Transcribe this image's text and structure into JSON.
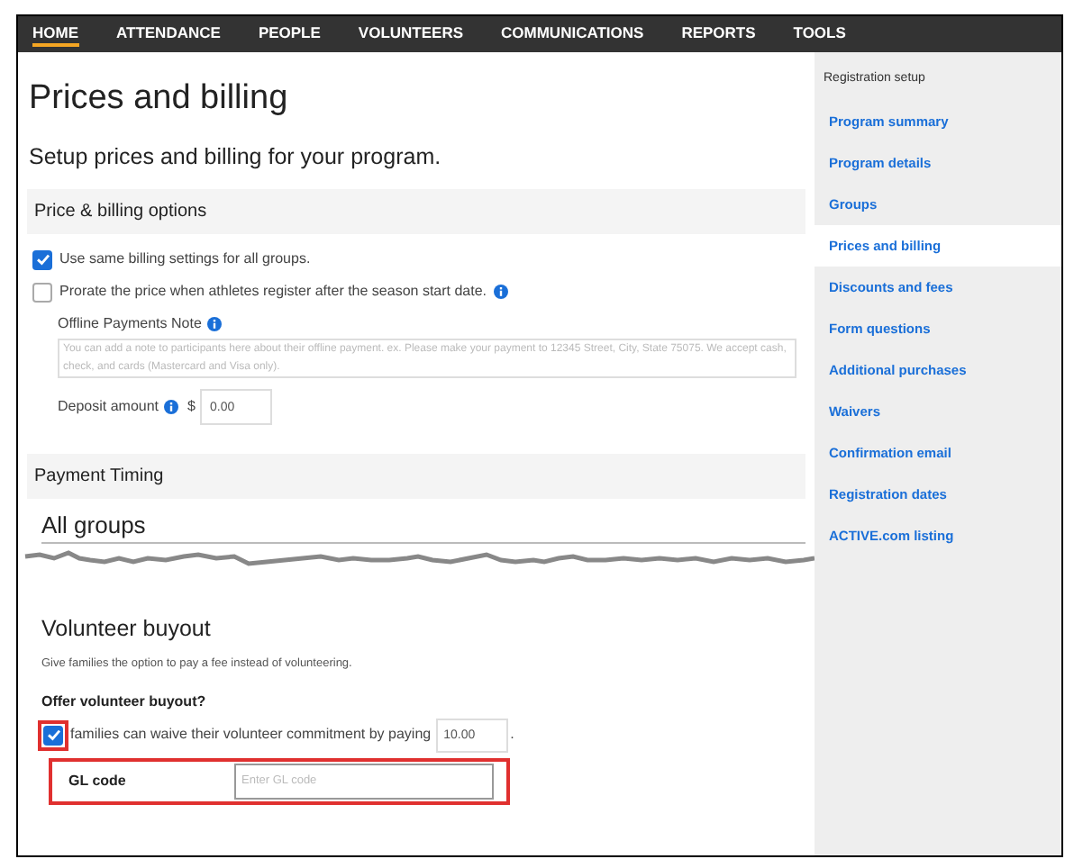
{
  "nav": [
    {
      "label": "HOME",
      "selected": true
    },
    {
      "label": "ATTENDANCE",
      "selected": false
    },
    {
      "label": "PEOPLE",
      "selected": false
    },
    {
      "label": "VOLUNTEERS",
      "selected": false
    },
    {
      "label": "COMMUNICATIONS",
      "selected": false
    },
    {
      "label": "REPORTS",
      "selected": false
    },
    {
      "label": "TOOLS",
      "selected": false
    }
  ],
  "page": {
    "title": "Prices and billing",
    "subtitle": "Setup prices and billing for your program."
  },
  "price_billing": {
    "heading": "Price & billing options",
    "options": [
      {
        "label": "Use same billing settings for all groups.",
        "checked": true,
        "info": false
      },
      {
        "label": "Prorate the price when athletes register after the season start date.",
        "checked": false,
        "info": true
      }
    ],
    "offline_note": {
      "label": "Offline Payments Note",
      "placeholder": "You can add a note to participants here about their offline payment. ex. Please make your payment to 12345 Street, City, State 75075. We accept cash, check, and cards (Mastercard and Visa only)."
    },
    "deposit": {
      "label": "Deposit amount",
      "currency": "$",
      "value": "0.00"
    }
  },
  "payment_timing": {
    "heading": "Payment Timing",
    "group_heading": "All groups"
  },
  "volunteer_buyout": {
    "heading": "Volunteer buyout",
    "description": "Give families the option to pay a fee instead of volunteering.",
    "question": "Offer volunteer buyout?",
    "option": {
      "label": "families can waive their volunteer commitment by paying",
      "checked": true,
      "value": "10.00",
      "suffix": "."
    },
    "gl_code": {
      "label": "GL code",
      "placeholder": "Enter GL code"
    }
  },
  "sidebar": {
    "heading": "Registration setup",
    "items": [
      {
        "label": "Program summary",
        "selected": false
      },
      {
        "label": "Program details",
        "selected": false
      },
      {
        "label": "Groups",
        "selected": false
      },
      {
        "label": "Prices and billing",
        "selected": true
      },
      {
        "label": "Discounts and fees",
        "selected": false
      },
      {
        "label": "Form questions",
        "selected": false
      },
      {
        "label": "Additional purchases",
        "selected": false
      },
      {
        "label": "Waivers",
        "selected": false
      },
      {
        "label": "Confirmation email",
        "selected": false
      },
      {
        "label": "Registration dates",
        "selected": false
      },
      {
        "label": "ACTIVE.com listing",
        "selected": false
      }
    ]
  }
}
